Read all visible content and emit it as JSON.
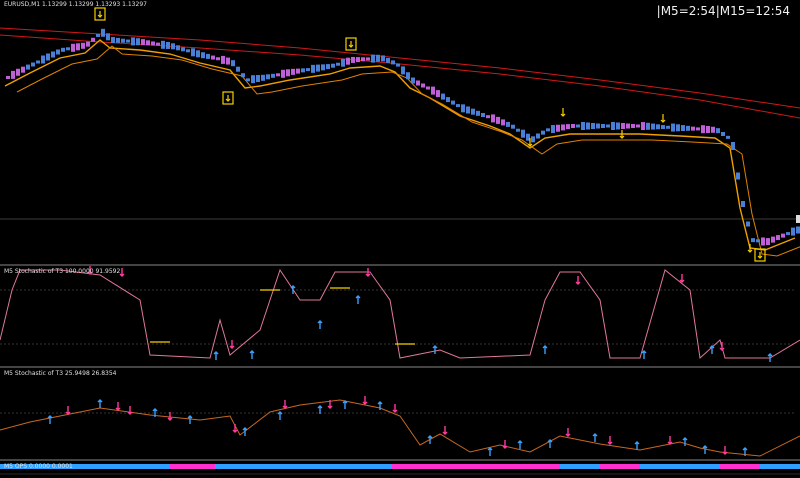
{
  "main": {
    "symbol_line": "EURUSD,M1  1.13299 1.13299 1.13293 1.13297",
    "timer": "|M5=2:54|M15=12:54"
  },
  "indicators": {
    "stoch1_label": "M5  Stochastic of T3 100.0000 91.9592",
    "stoch2_label": "M5  Stochastic of T3 25.9498 26.8354",
    "ops_label": "M5 OPS 0.0000 0.0001"
  },
  "colors": {
    "bull_candle": "#4a7fd6",
    "bear_candle": "#c060d8",
    "ma_red": "#d01818",
    "ma_orange": "#f0a000",
    "stoch_line": "#e07898",
    "stoch2_line": "#c86820",
    "arrow_up": "#3aa0ff",
    "arrow_down": "#ff3aa0",
    "signal_yellow": "#f5d000",
    "ops_blue": "#2fa0ff",
    "ops_magenta": "#ff2fd0"
  }
}
